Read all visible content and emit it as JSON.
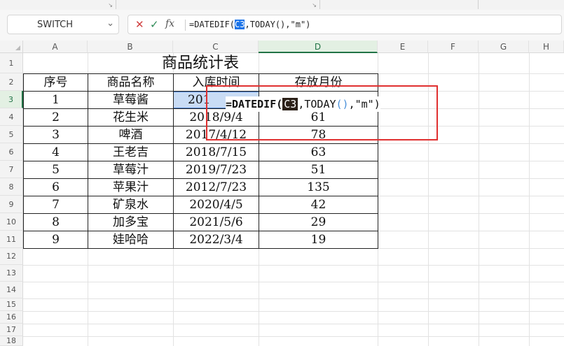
{
  "formula_bar": {
    "name_box": "SWITCH",
    "cancel_icon": "✕",
    "confirm_icon": "✓",
    "fx_label": "fx",
    "formula_parts": [
      "=DATEDIF(",
      "C3",
      ",TODAY(),\"m\")"
    ]
  },
  "columns": [
    "A",
    "B",
    "C",
    "D",
    "E",
    "F",
    "G",
    "H"
  ],
  "rows": [
    "1",
    "2",
    "3",
    "4",
    "5",
    "6",
    "7",
    "8",
    "9",
    "10",
    "11",
    "12",
    "13",
    "14",
    "15",
    "16",
    "17",
    "18"
  ],
  "sheet": {
    "title": "商品统计表",
    "headers": [
      "序号",
      "商品名称",
      "入库时间",
      "存放月份"
    ],
    "data": [
      [
        "1",
        "草莓酱",
        "201",
        ""
      ],
      [
        "2",
        "花生米",
        "2018/9/4",
        "61"
      ],
      [
        "3",
        "啤酒",
        "2017/4/12",
        "78"
      ],
      [
        "4",
        "王老吉",
        "2018/7/15",
        "63"
      ],
      [
        "5",
        "草莓汁",
        "2019/7/23",
        "51"
      ],
      [
        "6",
        "苹果汁",
        "2012/7/23",
        "135"
      ],
      [
        "7",
        "矿泉水",
        "2020/4/5",
        "42"
      ],
      [
        "8",
        "加多宝",
        "2021/5/6",
        "29"
      ],
      [
        "9",
        "娃哈哈",
        "2022/3/4",
        "19"
      ]
    ]
  },
  "cell_editor": {
    "parts": [
      "=DATEDIF(",
      "C3",
      ",TODAY",
      "()",
      ",\"m\")"
    ]
  },
  "colors": {
    "accent_green": "#217346",
    "highlight_red": "#e03030",
    "ref_blue": "#1a73e8"
  }
}
